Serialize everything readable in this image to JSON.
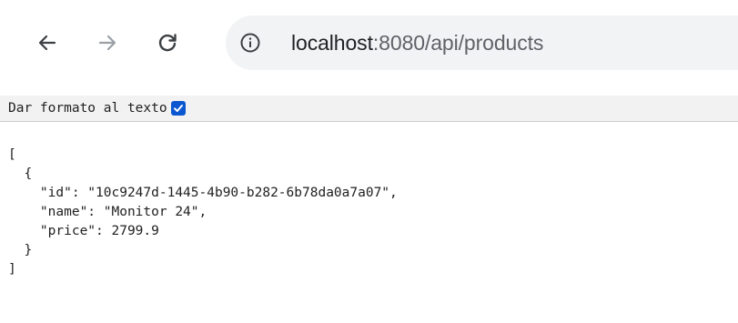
{
  "browser": {
    "url_host": "localhost",
    "url_rest": ":8080/api/products",
    "icons": {
      "back": "back-arrow-icon",
      "forward": "forward-arrow-icon",
      "reload": "reload-icon",
      "site_info": "info-icon"
    },
    "forward_disabled": true
  },
  "format_toggle": {
    "label": "Dar formato al texto",
    "checked": true,
    "accent_color": "#0b57d0"
  },
  "json_view": {
    "lines": [
      "[",
      "  {",
      "    \"id\": \"10c9247d-1445-4b90-b282-6b78da0a7a07\",",
      "    \"name\": \"Monitor 24\",",
      "    \"price\": 2799.9",
      "  }",
      "]"
    ]
  }
}
